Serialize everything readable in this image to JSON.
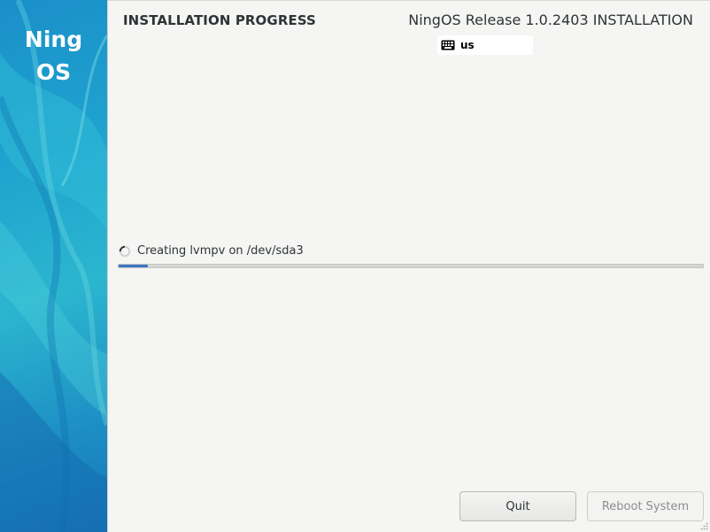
{
  "sidebar": {
    "brand_line1": "Ning",
    "brand_line2": "OS"
  },
  "header": {
    "page_title": "INSTALLATION PROGRESS",
    "product_title": "NingOS Release 1.0.2403 INSTALLATION",
    "keyboard_layout": "us"
  },
  "progress": {
    "status_text": "Creating lvmpv on /dev/sda3",
    "fraction": 0.05
  },
  "buttons": {
    "quit_label": "Quit",
    "reboot_label": "Reboot System",
    "reboot_enabled": false
  },
  "colors": {
    "progress_fill": "#3a75c2",
    "sidebar_accent": "#1fa3cf"
  },
  "icons": {
    "keyboard": "keyboard-icon",
    "spinner": "spinner-icon",
    "resize": "resize-grip-icon"
  }
}
